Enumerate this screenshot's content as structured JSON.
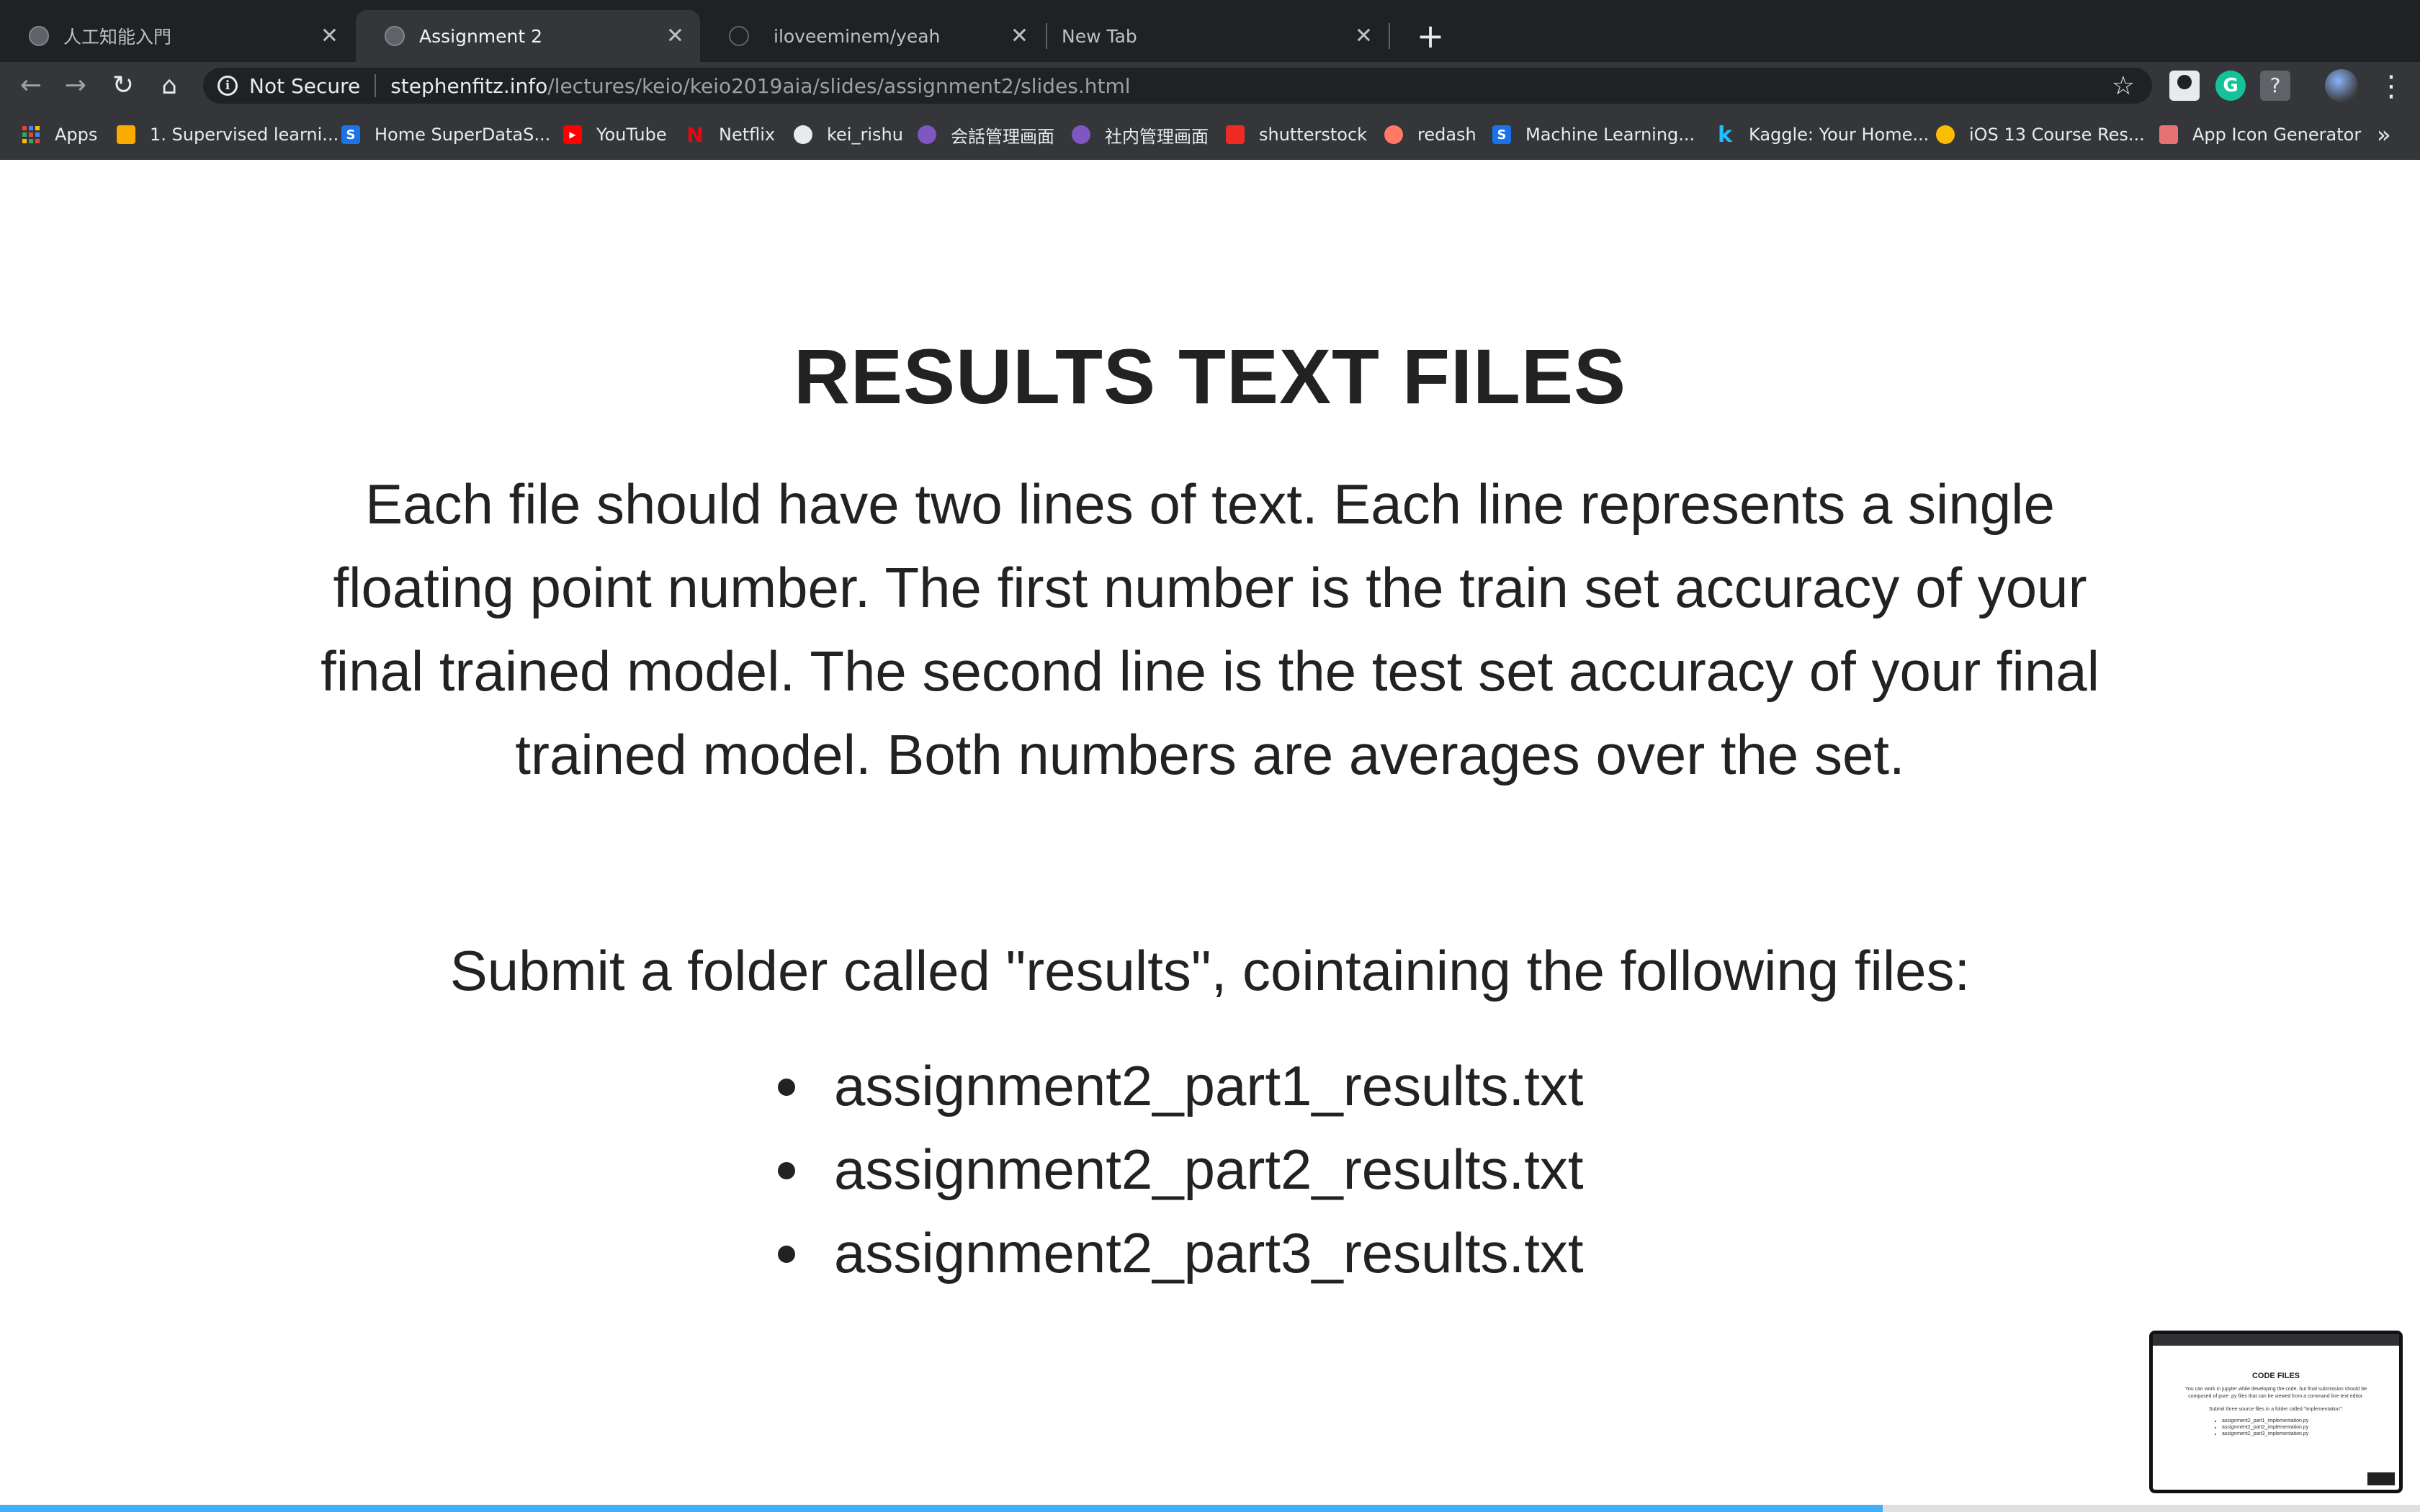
{
  "browser": {
    "tabs": [
      {
        "title": "人工知能入門",
        "active": false
      },
      {
        "title": "Assignment 2",
        "active": true
      },
      {
        "title": "iloveeminem/yeah",
        "active": false
      },
      {
        "title": "New Tab",
        "active": false
      }
    ],
    "new_tab_symbol": "+",
    "omnibox": {
      "security_label": "Not Secure",
      "url_host": "stephenfitz.info",
      "url_path": "/lectures/keio/keio2019aia/slides/assignment2/slides.html"
    },
    "bookmarks": [
      {
        "label": "Apps",
        "icon": "apps-grid-icon",
        "color": "#ea4335"
      },
      {
        "label": "1. Supervised learni...",
        "icon": "bookmark-icon",
        "color": "#f9ab00"
      },
      {
        "label": "Home SuperDataS...",
        "icon": "superdatascience-icon",
        "color": "#1a73e8"
      },
      {
        "label": "YouTube",
        "icon": "youtube-icon",
        "color": "#ff0000"
      },
      {
        "label": "Netflix",
        "icon": "netflix-icon",
        "color": "#e50914"
      },
      {
        "label": "kei_rishu",
        "icon": "globe-icon",
        "color": "#e8eaed"
      },
      {
        "label": "会話管理画面",
        "icon": "org-icon",
        "color": "#7e57c2"
      },
      {
        "label": "社内管理画面",
        "icon": "org-icon",
        "color": "#7e57c2"
      },
      {
        "label": "shutterstock",
        "icon": "shutterstock-icon",
        "color": "#ee2b24"
      },
      {
        "label": "redash",
        "icon": "redash-icon",
        "color": "#ff7964"
      },
      {
        "label": "Machine Learning...",
        "icon": "superdatascience-icon",
        "color": "#1a73e8"
      },
      {
        "label": "Kaggle: Your Home...",
        "icon": "kaggle-icon",
        "color": "#20beff"
      },
      {
        "label": "iOS 13 Course Res...",
        "icon": "course-icon",
        "color": "#fbbc04"
      },
      {
        "label": "App Icon Generator",
        "icon": "app-icon-generator-icon",
        "color": "#e57373"
      }
    ],
    "bookmarks_more": "»"
  },
  "slide": {
    "title": "RESULTS TEXT FILES",
    "paragraph1": "Each file should have two lines of text. Each line represents a single floating point number. The first number is the train set accuracy of your final trained model. The second line is the test set accuracy of your final trained model. Both numbers are averages over the set.",
    "paragraph2": "Submit a folder called \"results\", cointaining the following files:",
    "files": [
      "assignment2_part1_results.txt",
      "assignment2_part2_results.txt",
      "assignment2_part3_results.txt"
    ]
  },
  "progress": {
    "fraction": 0.778,
    "color": "#42affa"
  },
  "preview": {
    "title": "CODE FILES",
    "text": "You can work in jupyter while developing the code, but final submission should be composed of pure .py files that can be viewed from a command line text editor.",
    "text2": "Submit three source files in a folder called \"implementation\":",
    "files": [
      "assignment2_part1_implementation.py",
      "assignment2_part2_implementation.py",
      "assignment2_part3_implementation.py"
    ]
  }
}
